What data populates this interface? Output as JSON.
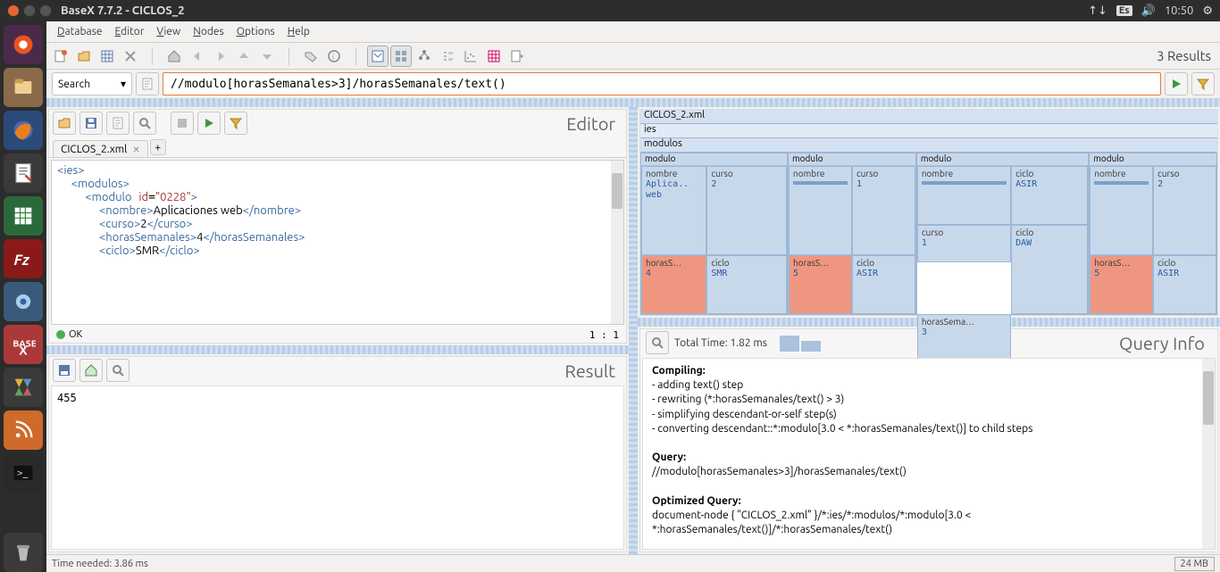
{
  "system": {
    "title": "BaseX 7.7.2 - CICLOS_2",
    "kb": "Es",
    "time": "10:50"
  },
  "menu": {
    "database": "Database",
    "editor": "Editor",
    "view": "View",
    "nodes": "Nodes",
    "options": "Options",
    "help": "Help"
  },
  "toolbar": {
    "results": "3 Results"
  },
  "search": {
    "label": "Search",
    "query": "//modulo[horasSemanales>3]/horasSemanales/text()"
  },
  "editor": {
    "title": "Editor",
    "tab": "CICLOS_2.xml",
    "status": "OK",
    "pos": "1 : 1"
  },
  "result": {
    "title": "Result",
    "value": "455"
  },
  "map": {
    "file": "CICLOS_2.xml",
    "root": "ies",
    "modulos": "modulos",
    "modulo": "modulo",
    "nombre": "nombre",
    "curso": "curso",
    "ciclo": "ciclo",
    "horas": "horasS…",
    "horasLong": "horasSema…",
    "m1": {
      "nombre": "Aplica.. web",
      "curso": "2",
      "horas": "4",
      "ciclo": "SMR"
    },
    "m2": {
      "curso": "1",
      "horas": "5",
      "ciclo": "ASIR"
    },
    "m3": {
      "ciclo1": "ASIR",
      "curso": "1",
      "horas2": "3",
      "ciclo2": "DAW"
    },
    "m4": {
      "curso": "2",
      "horas": "5",
      "ciclo": "ASIR"
    }
  },
  "qinfo": {
    "title": "Query Info",
    "total": "Total Time: 1.82 ms",
    "compiling": "Compiling:",
    "c1": "- adding text() step",
    "c2": "- rewriting (*:horasSemanales/text() > 3)",
    "c3": "- simplifying descendant-or-self step(s)",
    "c4": "- converting descendant::*:modulo[3.0 < *:horasSemanales/text()] to child steps",
    "query_h": "Query:",
    "query": "//modulo[horasSemanales>3]/horasSemanales/text()",
    "opt_h": "Optimized Query:",
    "opt": "document-node { \"CICLOS_2.xml\" }/*:ies/*:modulos/*:modulo[3.0 < *:horasSemanales/text()]/*:horasSemanales/text()"
  },
  "status": {
    "time": "Time needed: 3.86 ms",
    "mem": "24 MB"
  }
}
